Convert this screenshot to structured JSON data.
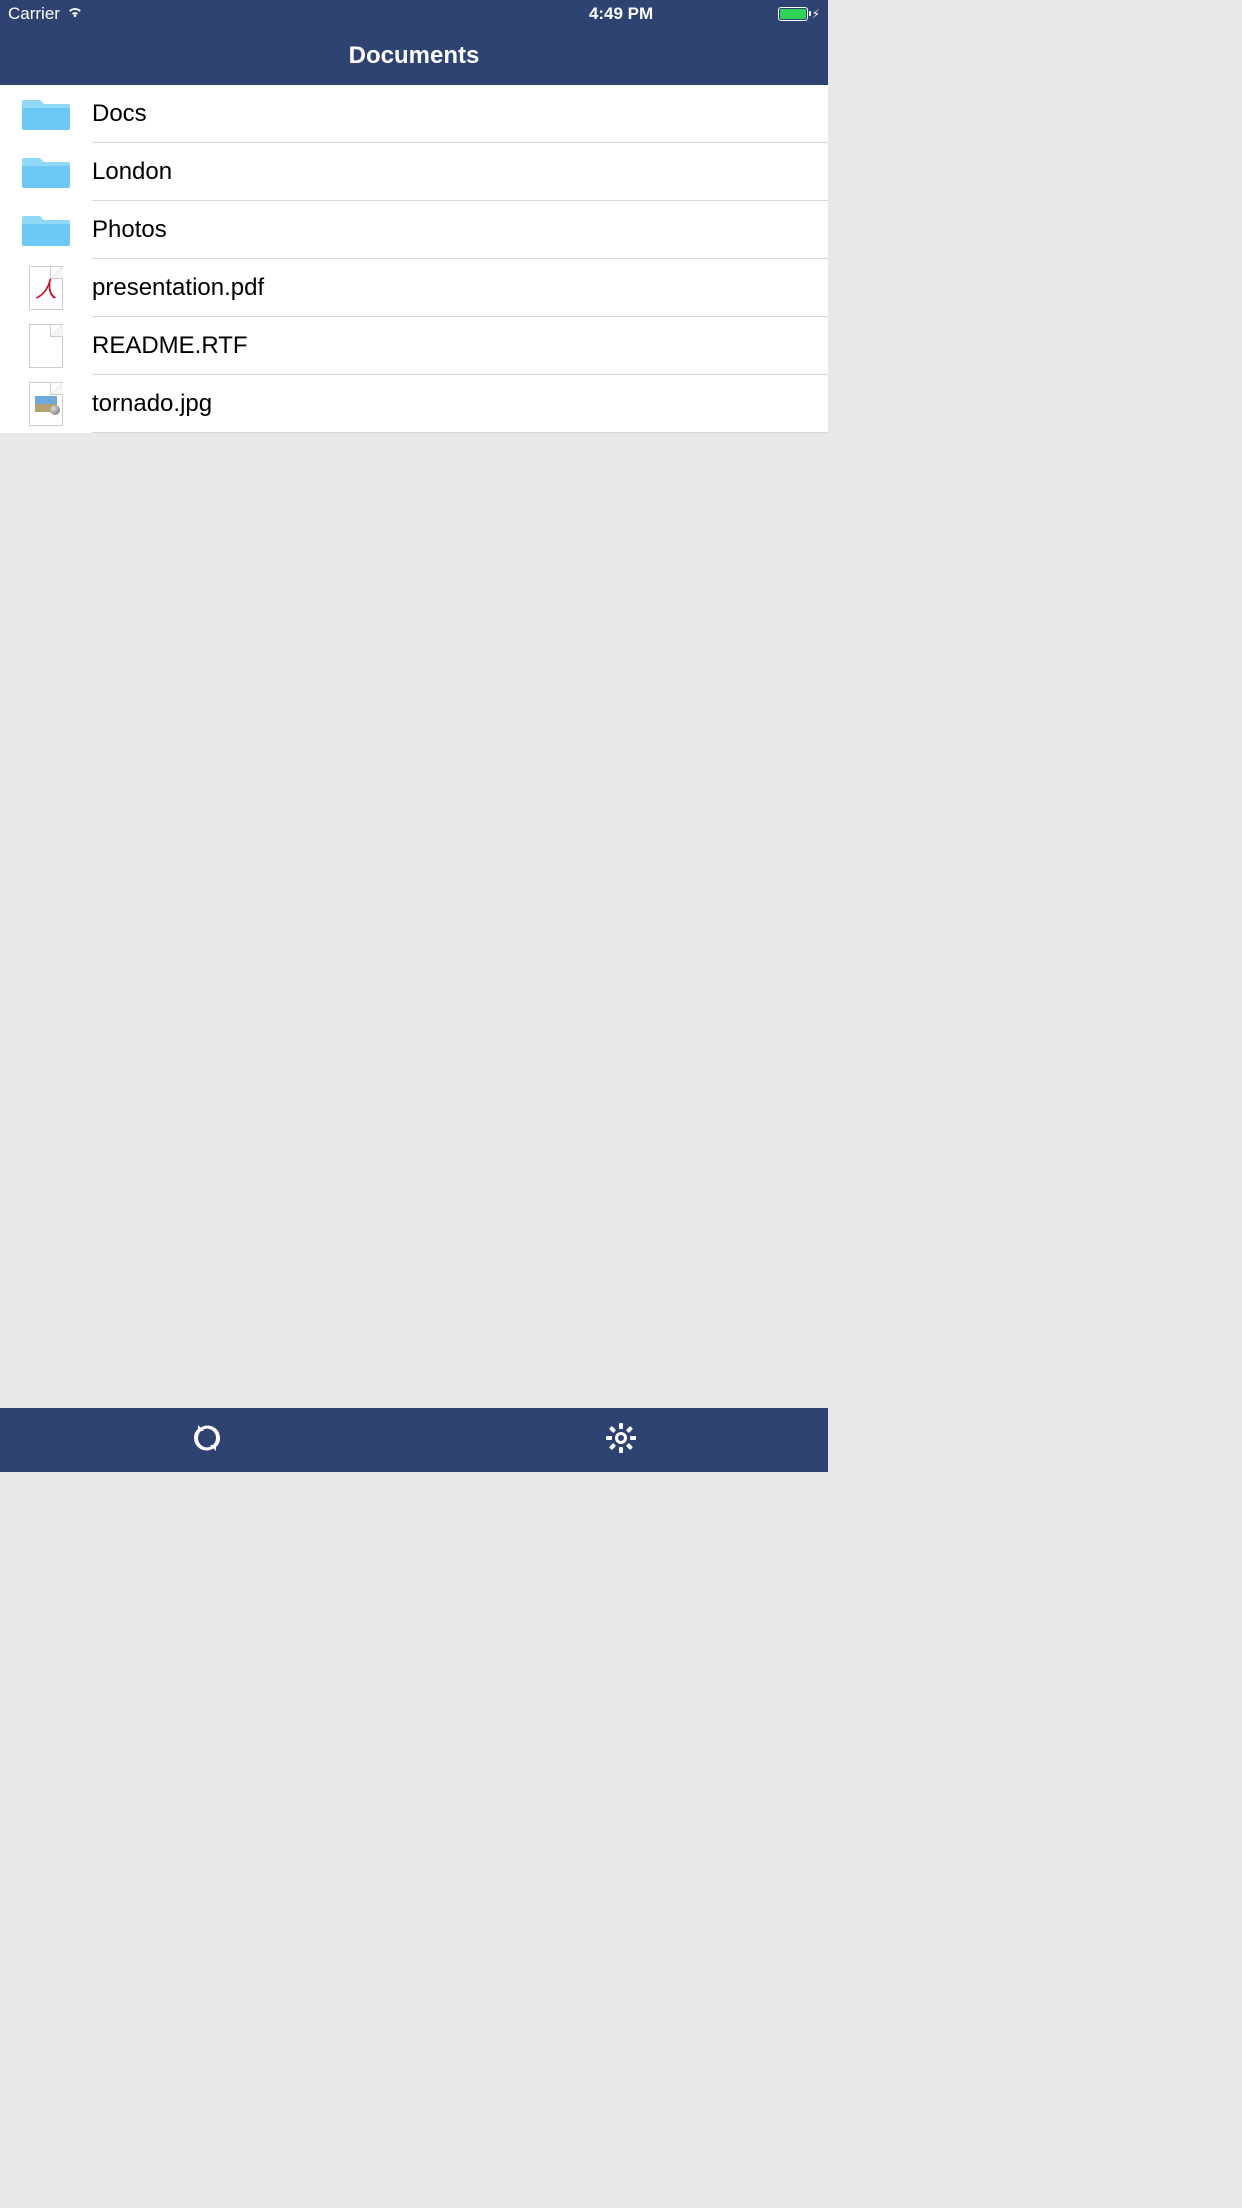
{
  "status_bar": {
    "carrier": "Carrier",
    "time": "4:49 PM"
  },
  "nav": {
    "title": "Documents"
  },
  "items": [
    {
      "type": "folder",
      "name": "Docs"
    },
    {
      "type": "folder",
      "name": "London"
    },
    {
      "type": "folder",
      "name": "Photos"
    },
    {
      "type": "pdf",
      "name": "presentation.pdf"
    },
    {
      "type": "rtf",
      "name": "README.RTF"
    },
    {
      "type": "image",
      "name": "tornado.jpg"
    }
  ],
  "toolbar": {
    "refresh_label": "Refresh",
    "settings_label": "Settings"
  },
  "colors": {
    "nav_bg": "#2e4371",
    "folder": "#6cc8f2",
    "battery_fill": "#30d158"
  }
}
